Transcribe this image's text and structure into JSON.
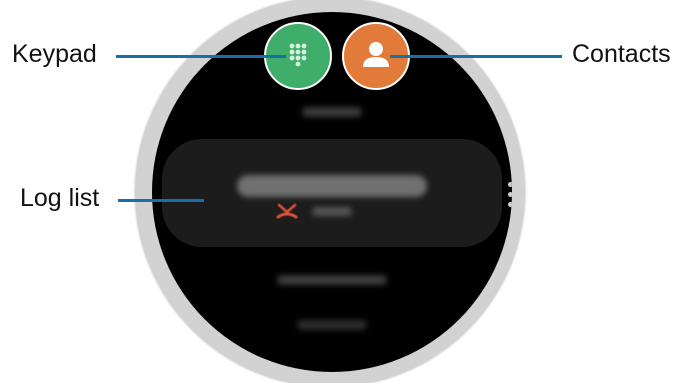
{
  "callouts": {
    "keypad": "Keypad",
    "contacts": "Contacts",
    "log_list": "Log list"
  },
  "colors": {
    "keypad_button": "#3fae6a",
    "contacts_button": "#e27a3a",
    "callout_line": "#1b6fa8",
    "missed_call": "#e2543a"
  },
  "icons": {
    "keypad": "keypad-icon",
    "contacts": "person-icon",
    "missed_call": "missed-call-icon",
    "more": "more-options-icon"
  }
}
